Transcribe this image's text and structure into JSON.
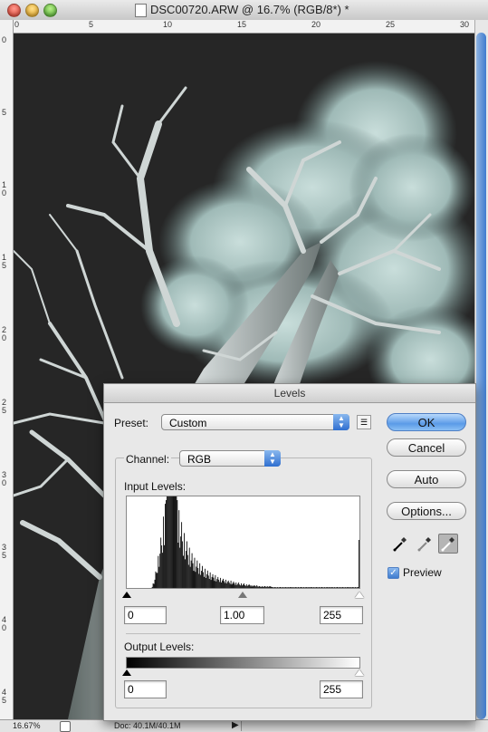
{
  "window": {
    "title": "DSC00720.ARW @ 16.7% (RGB/8*) *"
  },
  "rulers": {
    "top_labels": [
      "0",
      "5",
      "10",
      "15",
      "20",
      "25",
      "30"
    ],
    "left_labels": [
      "0",
      "5",
      "1 0",
      "1 5",
      "2 0",
      "2 5",
      "3 0",
      "3 5",
      "4 0",
      "4 5"
    ]
  },
  "status": {
    "zoom": "16.67%",
    "doc": "Doc: 40.1M/40.1M"
  },
  "levels": {
    "title": "Levels",
    "preset_label": "Preset:",
    "preset_value": "Custom",
    "channel_label": "Channel:",
    "channel_value": "RGB",
    "input_levels_label": "Input Levels:",
    "input_black": "0",
    "input_gamma": "1.00",
    "input_white": "255",
    "output_levels_label": "Output Levels:",
    "output_black": "0",
    "output_white": "255",
    "buttons": {
      "ok": "OK",
      "cancel": "Cancel",
      "auto": "Auto",
      "options": "Options..."
    },
    "preview_label": "Preview",
    "preview_checked": true
  },
  "colors": {
    "accent": "#3f7ccf",
    "canvas_bg": "#252525",
    "foliage": "#b7cfcd"
  },
  "chart_data": {
    "type": "bar",
    "values": [
      0,
      0,
      0,
      0,
      0,
      0,
      0,
      0,
      0,
      0,
      0,
      0,
      0,
      0,
      0,
      0,
      0,
      0,
      0,
      0,
      0,
      0,
      0,
      0,
      0,
      0,
      0,
      0,
      0,
      2,
      5,
      8,
      12,
      18,
      22,
      30,
      35,
      42,
      50,
      55,
      62,
      70,
      78,
      85,
      92,
      96,
      100,
      100,
      100,
      100,
      100,
      100,
      100,
      100,
      100,
      100,
      100,
      100,
      96,
      90,
      85,
      80,
      75,
      72,
      68,
      64,
      60,
      57,
      54,
      51,
      48,
      46,
      44,
      42,
      40,
      38,
      36,
      34,
      33,
      32,
      31,
      30,
      29,
      28,
      27,
      26,
      25,
      24,
      23,
      22,
      21,
      20,
      20,
      19,
      18,
      18,
      17,
      16,
      16,
      15,
      15,
      14,
      14,
      13,
      13,
      12,
      12,
      12,
      11,
      11,
      11,
      10,
      10,
      10,
      9,
      9,
      9,
      8,
      8,
      8,
      8,
      7,
      7,
      7,
      7,
      6,
      6,
      6,
      6,
      6,
      5,
      5,
      5,
      5,
      5,
      5,
      4,
      4,
      4,
      4,
      4,
      4,
      4,
      3,
      3,
      3,
      3,
      3,
      3,
      3,
      3,
      3,
      2,
      2,
      2,
      2,
      2,
      2,
      2,
      2,
      2,
      2,
      2,
      2,
      2,
      2,
      2,
      2,
      1,
      1,
      1,
      1,
      1,
      1,
      1,
      1,
      1,
      1,
      1,
      1,
      1,
      1,
      1,
      1,
      1,
      1,
      1,
      1,
      1,
      1,
      1,
      1,
      1,
      1,
      1,
      1,
      1,
      1,
      1,
      1,
      1,
      1,
      1,
      1,
      1,
      1,
      1,
      1,
      1,
      1,
      1,
      1,
      1,
      1,
      1,
      1,
      1,
      1,
      1,
      1,
      1,
      1,
      1,
      1,
      1,
      1,
      1,
      1,
      1,
      1,
      1,
      1,
      1,
      1,
      1,
      1,
      1,
      1,
      1,
      1,
      1,
      1,
      1,
      1,
      1,
      1,
      1,
      1,
      1,
      1,
      1,
      1,
      1,
      1,
      1,
      1,
      1,
      1,
      1,
      1,
      1,
      1,
      1,
      1,
      1,
      1,
      1,
      1,
      70
    ],
    "ylim": [
      0,
      100
    ]
  }
}
